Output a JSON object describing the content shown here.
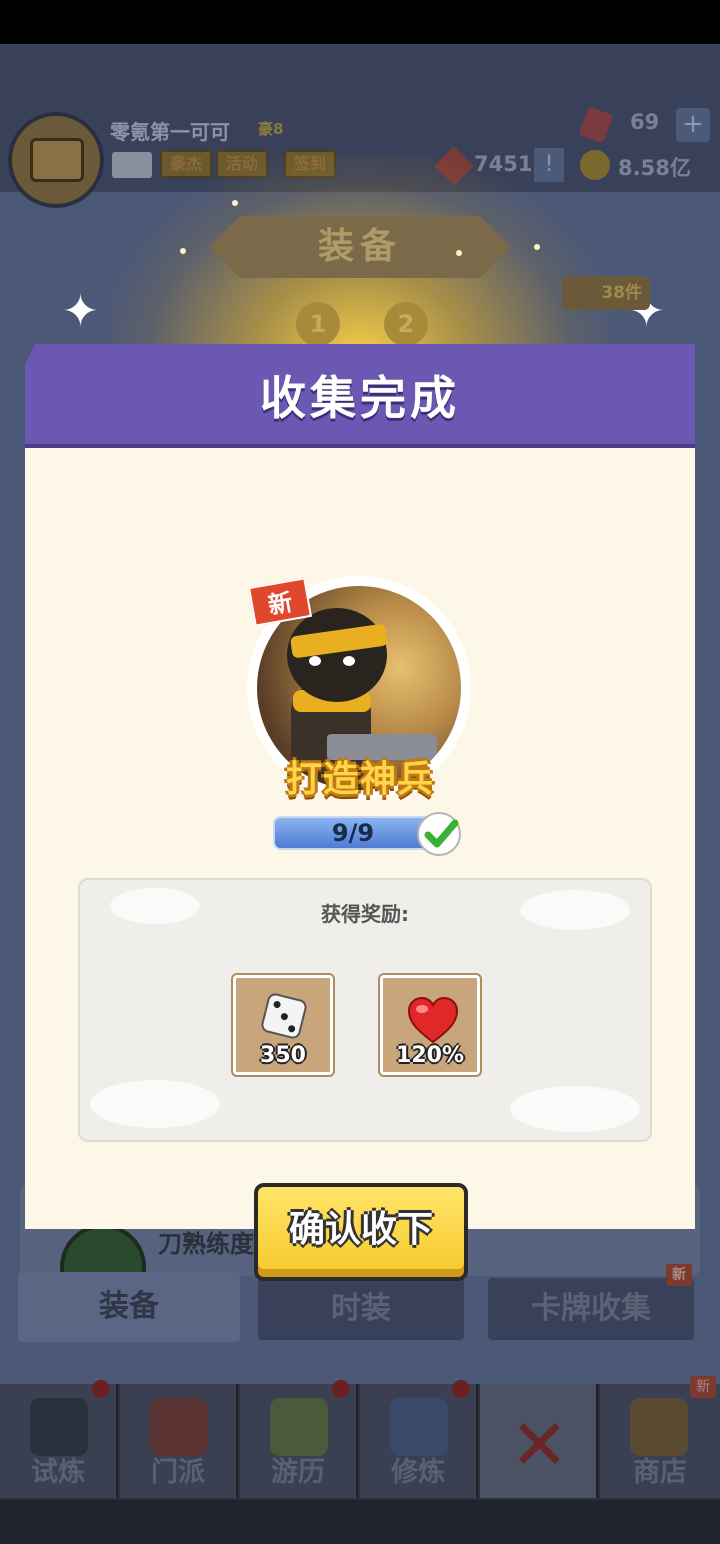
{
  "player": {
    "name": "零氪第一可可",
    "vip": "豪8"
  },
  "tags": [
    "豪杰",
    "活动",
    "签到"
  ],
  "resources": {
    "gems": "69",
    "tickets": "7451",
    "gold": "8.58亿"
  },
  "screen_title": "装备",
  "steps": [
    "1",
    "2"
  ],
  "count_badge": "38件",
  "mastery_label": "刀熟练度",
  "tabs": [
    {
      "label": "装备"
    },
    {
      "label": "时装"
    },
    {
      "label": "卡牌收集",
      "badge": "新"
    }
  ],
  "bottom_nav": [
    {
      "label": "试炼",
      "icon": "ninja-icon"
    },
    {
      "label": "门派",
      "icon": "temple-icon"
    },
    {
      "label": "游历",
      "icon": "mountain-icon"
    },
    {
      "label": "修炼",
      "icon": "scroll-icon"
    },
    {
      "label": "",
      "icon": "close-x-icon"
    },
    {
      "label": "商店",
      "icon": "shop-icon",
      "badge": "新"
    }
  ],
  "modal": {
    "title": "收集完成",
    "card": {
      "badge": "新",
      "name": "打造神兵"
    },
    "progress": {
      "text": "9/9",
      "current": 9,
      "total": 9
    },
    "reward_title": "获得奖励:",
    "rewards": [
      {
        "icon": "dice-icon",
        "amount": "350"
      },
      {
        "icon": "heart-icon",
        "amount": "120%"
      }
    ],
    "confirm_label": "确认收下"
  },
  "colors": {
    "header": "#6a58b2",
    "body": "#fdf7e7",
    "confirm": "#f6c92a",
    "progress": "#5a88d8",
    "new_badge": "#e0482e"
  }
}
